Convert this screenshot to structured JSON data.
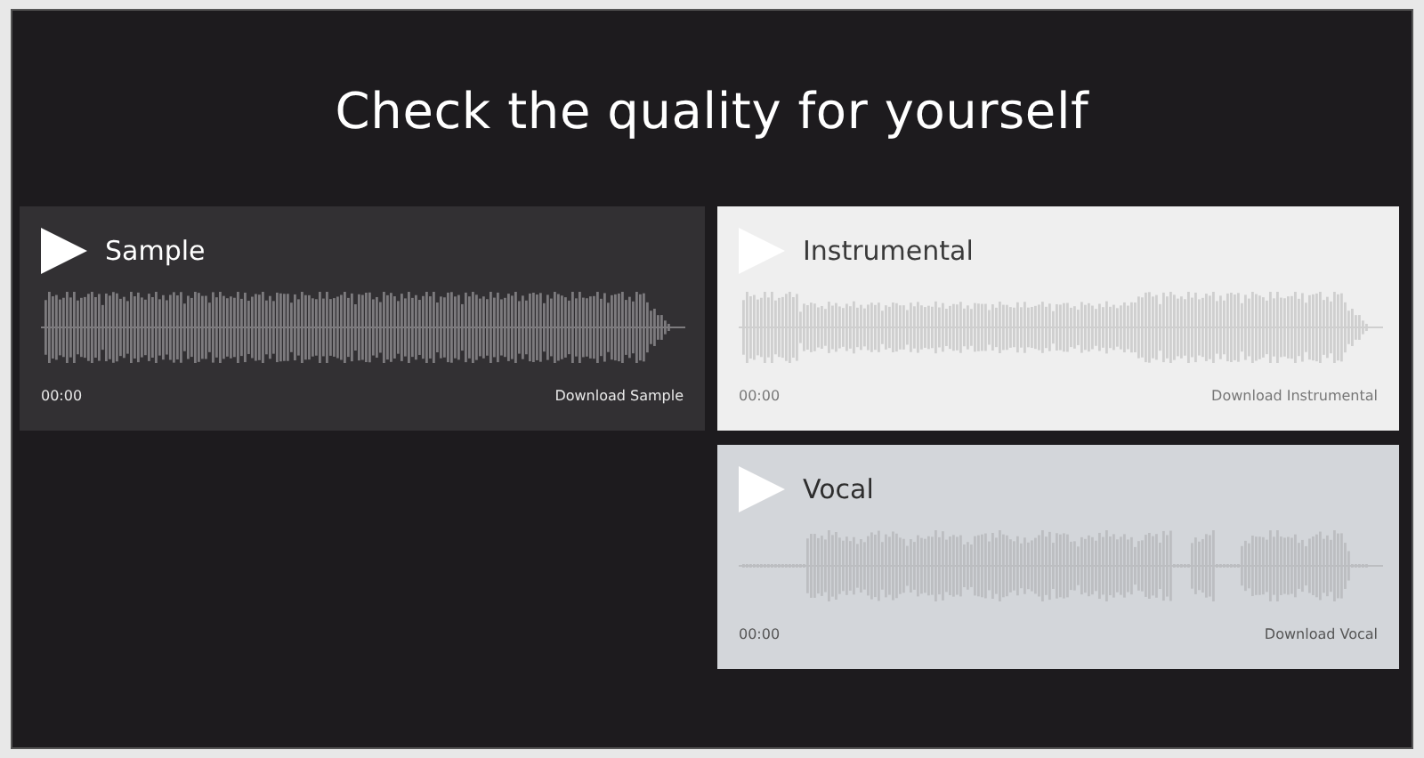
{
  "heading": "Check the quality for yourself",
  "players": [
    {
      "kind": "dark",
      "title": "Sample",
      "time": "00:00",
      "download": "Download Sample"
    },
    {
      "kind": "light",
      "title": "Instrumental",
      "time": "00:00",
      "download": "Download Instrumental"
    },
    {
      "kind": "vocal",
      "title": "Vocal",
      "time": "00:00",
      "download": "Download Vocal"
    }
  ]
}
